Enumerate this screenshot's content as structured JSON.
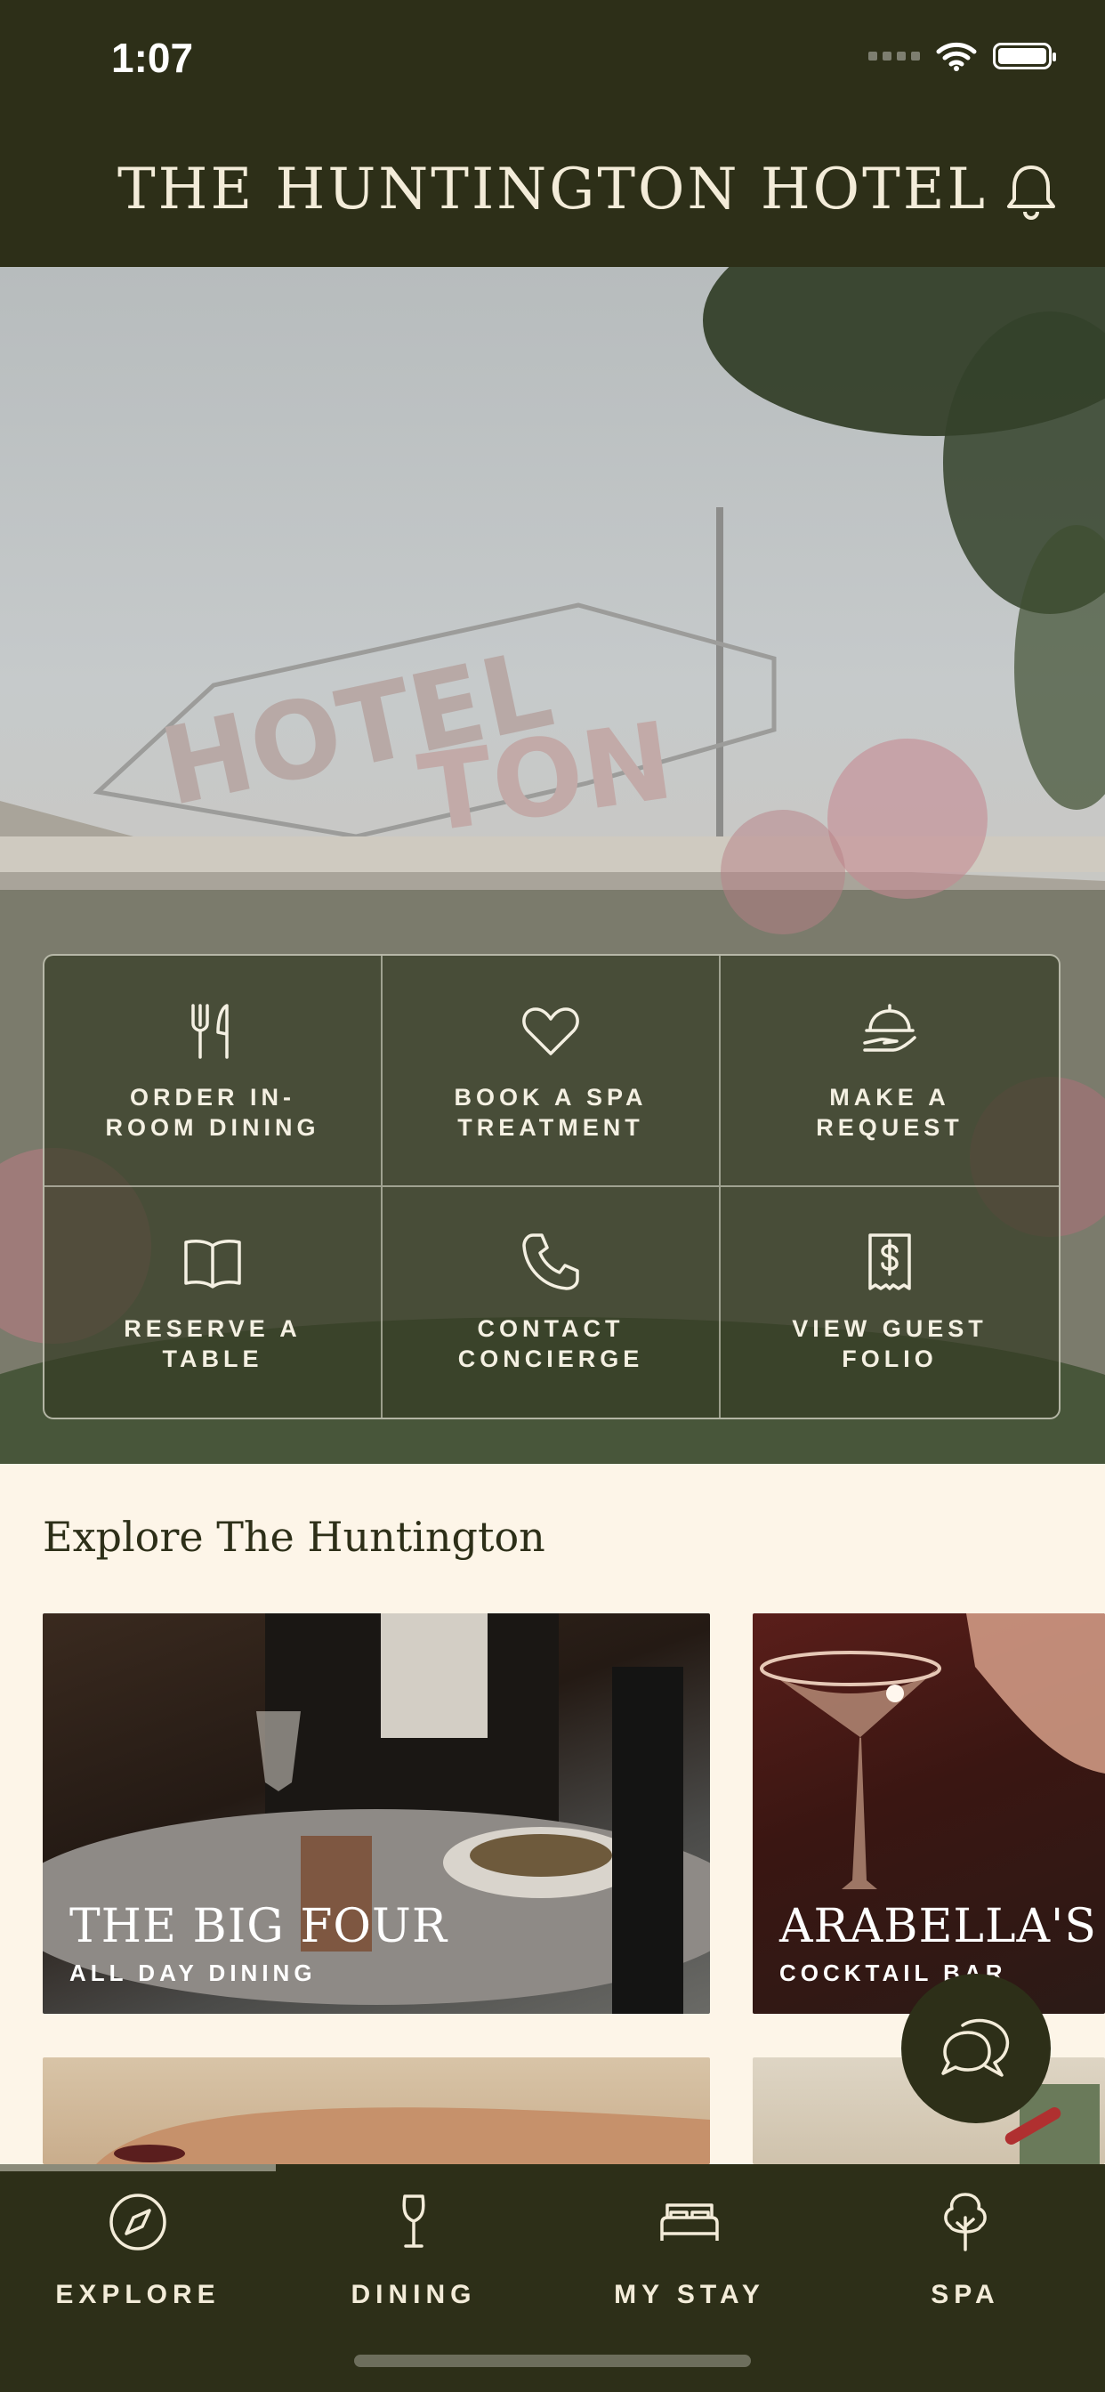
{
  "status_bar": {
    "time": "1:07"
  },
  "header": {
    "title": "THE HUNTINGTON HOTEL",
    "bell_icon": "bell-icon"
  },
  "quick_actions": [
    {
      "label": "ORDER IN-ROOM DINING",
      "icon": "fork-knife-icon"
    },
    {
      "label": "BOOK A SPA TREATMENT",
      "icon": "heart-icon"
    },
    {
      "label": "MAKE A REQUEST",
      "icon": "cloche-icon"
    },
    {
      "label": "RESERVE A TABLE",
      "icon": "book-icon"
    },
    {
      "label": "CONTACT CONCIERGE",
      "icon": "phone-icon"
    },
    {
      "label": "VIEW GUEST FOLIO",
      "icon": "receipt-dollar-icon"
    }
  ],
  "explore": {
    "heading": "Explore The Huntington",
    "cards": [
      {
        "title": "THE BIG FOUR",
        "subtitle": "ALL DAY DINING"
      },
      {
        "title": "ARABELLA'S",
        "subtitle": "COCKTAIL BAR"
      }
    ]
  },
  "tabbar": {
    "tabs": [
      {
        "label": "EXPLORE",
        "icon": "compass-icon",
        "active": true
      },
      {
        "label": "DINING",
        "icon": "wine-glass-icon"
      },
      {
        "label": "MY STAY",
        "icon": "bed-icon"
      },
      {
        "label": "SPA",
        "icon": "tree-icon"
      }
    ]
  },
  "colors": {
    "primary": "#2d2f18",
    "cream": "#fdf5e8",
    "text_light": "#f3ecd9"
  }
}
